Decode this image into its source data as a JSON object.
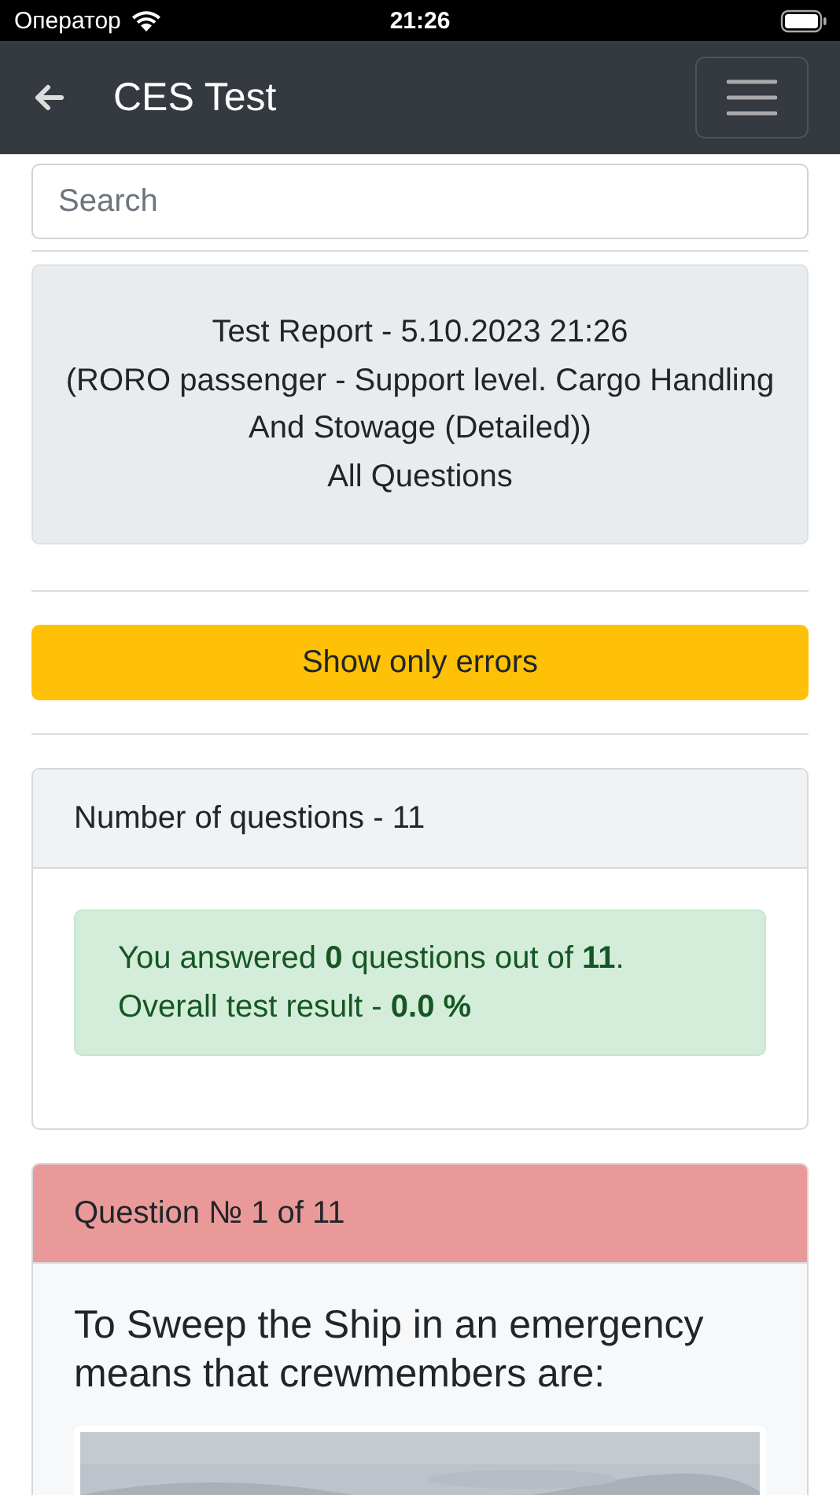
{
  "status_bar": {
    "carrier": "Оператор",
    "time": "21:26"
  },
  "navbar": {
    "title": "CES Test"
  },
  "search": {
    "placeholder": "Search"
  },
  "report": {
    "lines": [
      "Test Report - 5.10.2023 21:26",
      "(RORO passenger - Support level. Cargo Handling And Stowage (Detailed))",
      "All Questions"
    ]
  },
  "filter_button": {
    "label": "Show only errors"
  },
  "summary": {
    "header": "Number of questions - 11",
    "result_lines": [
      "You answered **0** questions out of **11**.",
      "Overall test result - **0.0 %**"
    ]
  },
  "question": {
    "header": "Question № 1 of 11",
    "correct": false,
    "text": "To Sweep the Ship in an emergency means that crewmembers are:"
  }
}
